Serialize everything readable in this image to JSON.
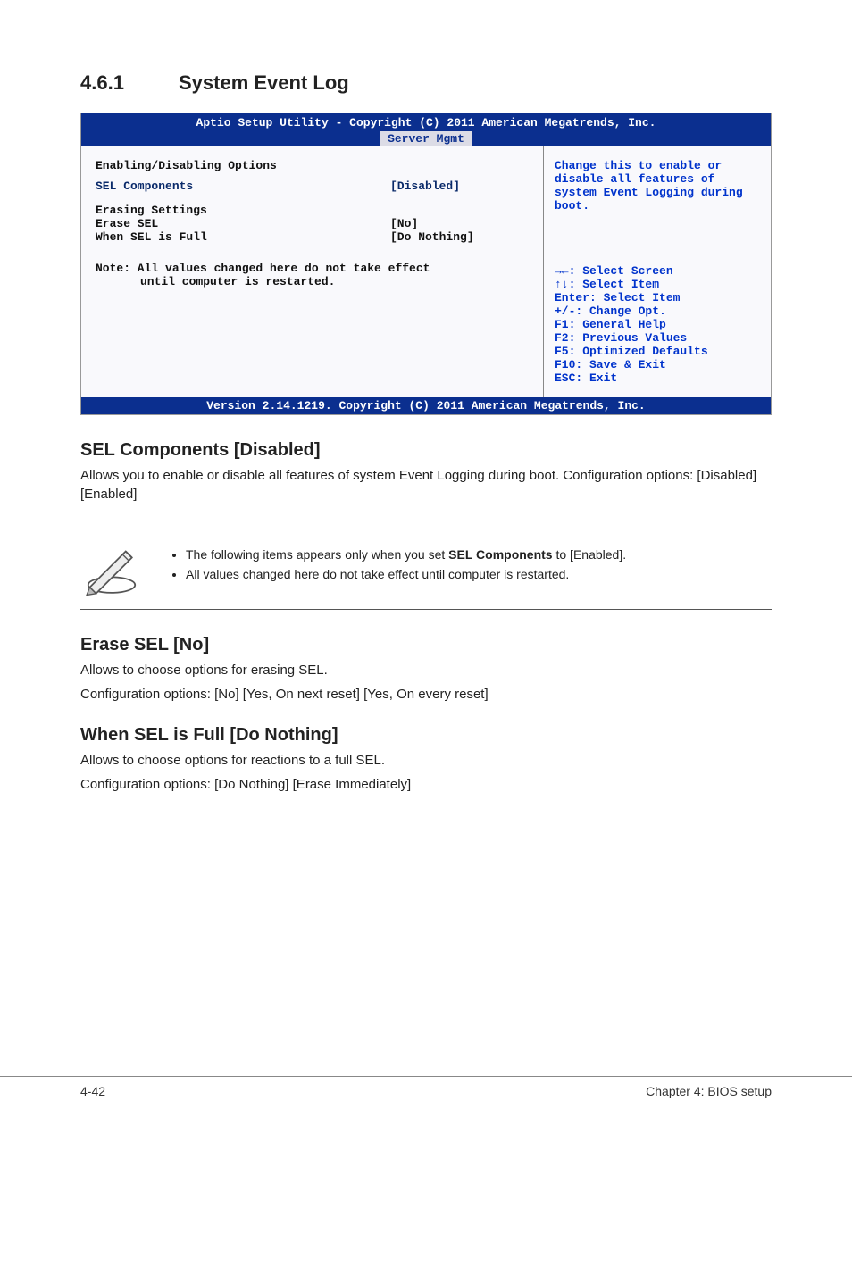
{
  "heading": {
    "number": "4.6.1",
    "title": "System Event Log"
  },
  "bios": {
    "top_line": "Aptio Setup Utility - Copyright (C) 2011 American Megatrends, Inc.",
    "tab": "Server Mgmt",
    "left": {
      "l1": "Enabling/Disabling Options",
      "sel_label": "SEL Components",
      "sel_val": "[Disabled]",
      "erase_title": "Erasing Settings",
      "erase_label": "Erase SEL",
      "erase_val": "[No]",
      "full_label": "When SEL is Full",
      "full_val": "[Do Nothing]",
      "note1": "Note: All values changed here do not take effect",
      "note2": "until computer is restarted."
    },
    "right": {
      "help1": "Change this to enable or disable all features of system Event Logging during boot.",
      "nav1": "→←: Select Screen",
      "nav2": "↑↓:  Select Item",
      "nav3": "Enter: Select Item",
      "nav4": "+/-: Change Opt.",
      "nav5": "F1: General Help",
      "nav6": "F2: Previous Values",
      "nav7": "F5: Optimized Defaults",
      "nav8": "F10: Save & Exit",
      "nav9": "ESC: Exit"
    },
    "footer": "Version 2.14.1219. Copyright (C) 2011 American Megatrends, Inc."
  },
  "sections": {
    "s1_title": "SEL Components [Disabled]",
    "s1_p1": "Allows you to enable or disable all features of system Event Logging during boot. Configuration options: [Disabled] [Enabled]",
    "note_li1_a": "The following items appears only when you set ",
    "note_li1_b": "SEL Components",
    "note_li1_c": " to [Enabled].",
    "note_li2": "All values changed here do not take effect until computer is restarted.",
    "s2_title": "Erase SEL [No]",
    "s2_p1": "Allows to choose options for erasing SEL.",
    "s2_p2": "Configuration options: [No] [Yes, On next reset] [Yes, On every reset]",
    "s3_title": "When SEL is Full [Do Nothing]",
    "s3_p1": "Allows to choose options for reactions to a full SEL.",
    "s3_p2": "Configuration options: [Do Nothing] [Erase Immediately]"
  },
  "footer": {
    "left": "4-42",
    "right": "Chapter 4: BIOS setup"
  }
}
